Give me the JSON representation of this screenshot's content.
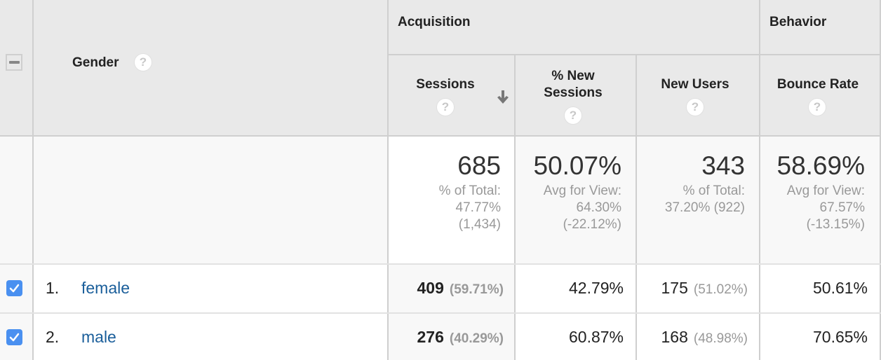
{
  "table": {
    "dimension_header": "Gender",
    "groups": [
      {
        "label": "Acquisition"
      },
      {
        "label": "Behavior"
      }
    ],
    "columns": [
      {
        "label_line1": "Sessions",
        "label_line2": "",
        "sorted": "descending"
      },
      {
        "label_line1": "% New",
        "label_line2": "Sessions"
      },
      {
        "label_line1": "New Users",
        "label_line2": ""
      },
      {
        "label_line1": "Bounce Rate",
        "label_line2": ""
      }
    ],
    "help_glyph": "?",
    "totals": [
      {
        "main": "685",
        "sub1": "% of Total:",
        "sub2": "47.77%",
        "sub3": "(1,434)"
      },
      {
        "main": "50.07%",
        "sub1": "Avg for View:",
        "sub2": "64.30%",
        "sub3": "(-22.12%)"
      },
      {
        "main": "343",
        "sub1": "% of Total:",
        "sub2": "37.20% (922)",
        "sub3": ""
      },
      {
        "main": "58.69%",
        "sub1": "Avg for View:",
        "sub2": "67.57%",
        "sub3": "(-13.15%)"
      }
    ],
    "rows": [
      {
        "checked": true,
        "index": "1.",
        "label": "female",
        "sessions": "409",
        "sessions_pct": "(59.71%)",
        "pct_new_sessions": "42.79%",
        "new_users": "175",
        "new_users_pct": "(51.02%)",
        "bounce_rate": "50.61%"
      },
      {
        "checked": true,
        "index": "2.",
        "label": "male",
        "sessions": "276",
        "sessions_pct": "(40.29%)",
        "pct_new_sessions": "60.87%",
        "new_users": "168",
        "new_users_pct": "(48.98%)",
        "bounce_rate": "70.65%"
      }
    ]
  },
  "colors": {
    "link": "#1a5e9a",
    "checkbox": "#4a90f0",
    "header_bg": "#e9e9e9",
    "border": "#cfcfcf"
  }
}
